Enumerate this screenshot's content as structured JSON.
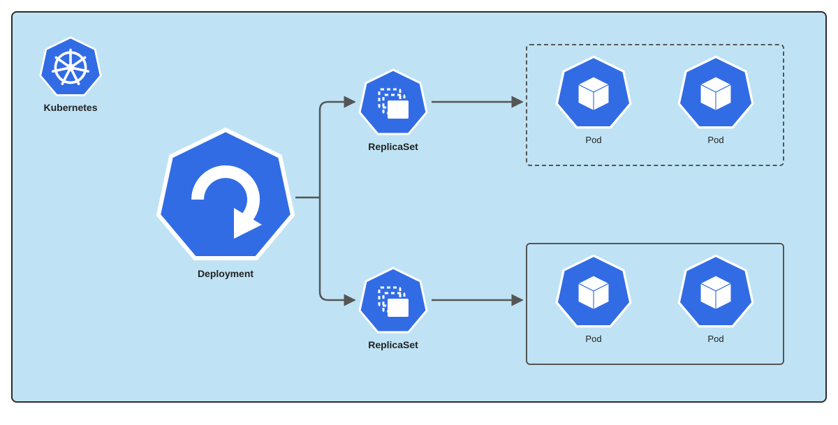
{
  "brand": {
    "label": "Kubernetes"
  },
  "deployment": {
    "label": "Deployment"
  },
  "replicaset_top": {
    "label": "ReplicaSet"
  },
  "replicaset_bottom": {
    "label": "ReplicaSet"
  },
  "pods_top": {
    "p1": "Pod",
    "p2": "Pod"
  },
  "pods_bottom": {
    "p1": "Pod",
    "p2": "Pod"
  },
  "colors": {
    "k8s_blue": "#326ce5",
    "outline": "#ffffff",
    "arrow": "#555555"
  }
}
